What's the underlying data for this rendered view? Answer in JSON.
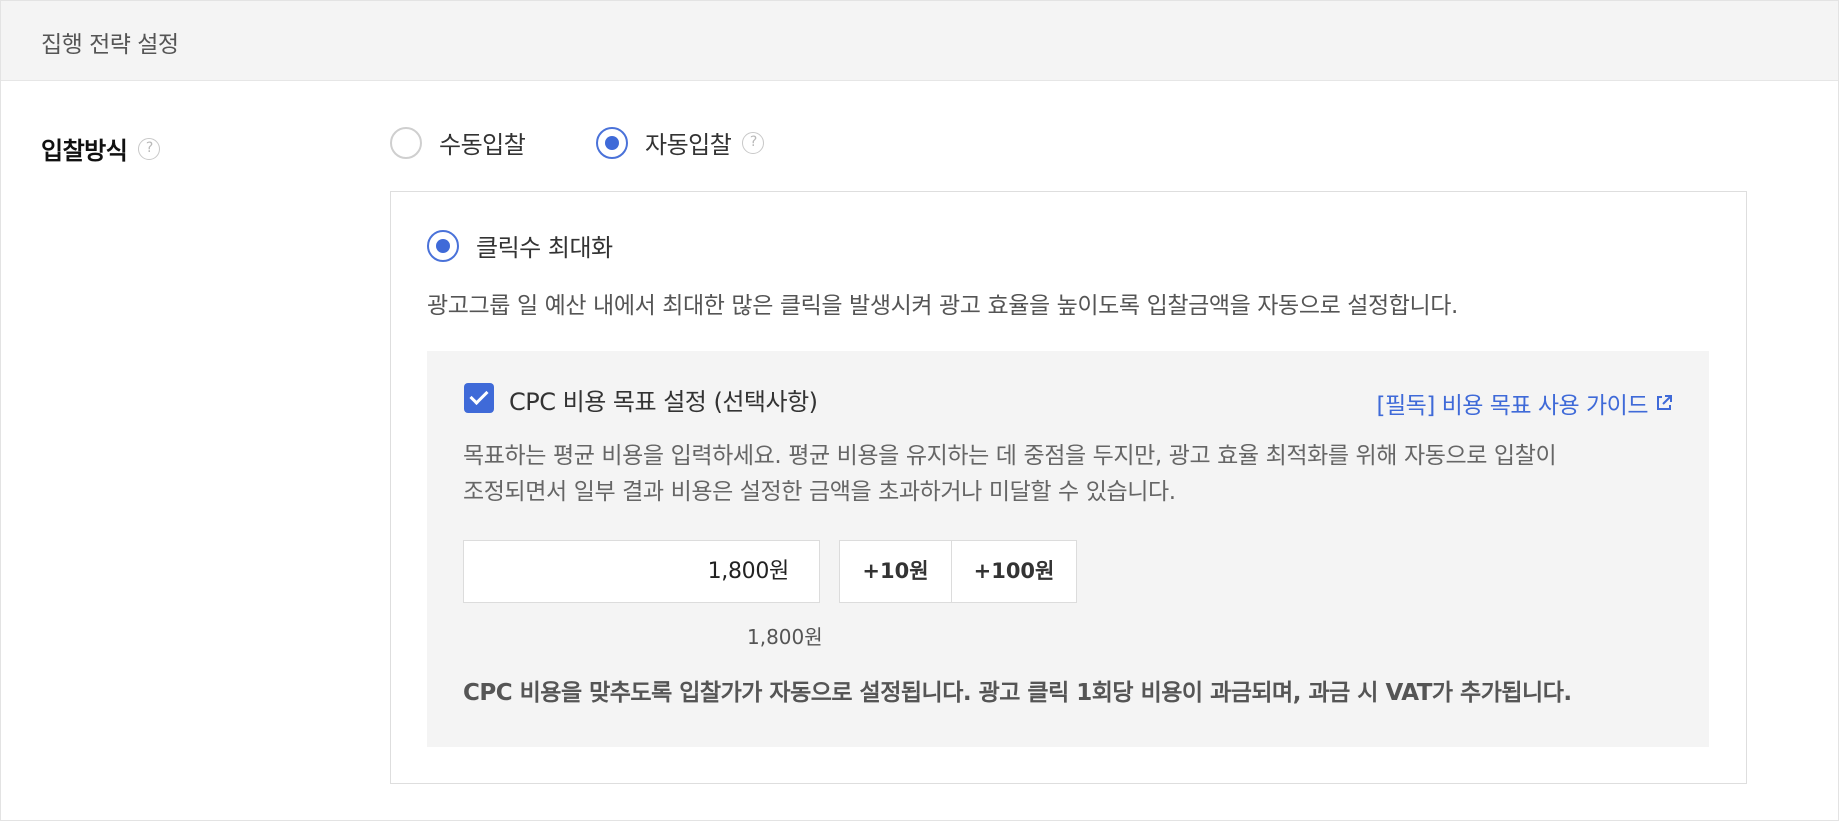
{
  "header": {
    "title": "집행 전략 설정"
  },
  "bid_method": {
    "label": "입찰방식",
    "help_icon": "question-circle-icon",
    "options": [
      {
        "label": "수동입찰",
        "selected": false
      },
      {
        "label": "자동입찰",
        "selected": true
      }
    ]
  },
  "auto_bid": {
    "strategy_label": "클릭수 최대화",
    "strategy_selected": true,
    "description": "광고그룹 일 예산 내에서 최대한 많은 클릭을 발생시켜 광고 효율을 높이도록 입찰금액을 자동으로 설정합니다.",
    "cpc": {
      "checkbox_checked": true,
      "title": "CPC 비용 목표 설정 (선택사항)",
      "guide_link": "[필독] 비용 목표 사용 가이드",
      "guide_icon": "external-link-icon",
      "description_line1": "목표하는 평균 비용을 입력하세요. 평균 비용을 유지하는 데 중점을 두지만, 광고 효율 최적화를 위해 자동으로 입찰이",
      "description_line2": "조정되면서 일부 결과 비용은 설정한 금액을 초과하거나 미달할 수 있습니다.",
      "amount_value": "1,800원",
      "plus10_label": "+10원",
      "plus100_label": "+100원",
      "amount_echo": "1,800원",
      "note": "CPC 비용을 맞추도록 입찰가가 자동으로 설정됩니다. 광고 클릭 1회당 비용이 과금되며, 과금 시 VAT가 추가됩니다."
    }
  },
  "colors": {
    "accent": "#3f6ad8",
    "panel_header_bg": "#f4f4f4",
    "gray_box_bg": "#f4f4f4"
  }
}
